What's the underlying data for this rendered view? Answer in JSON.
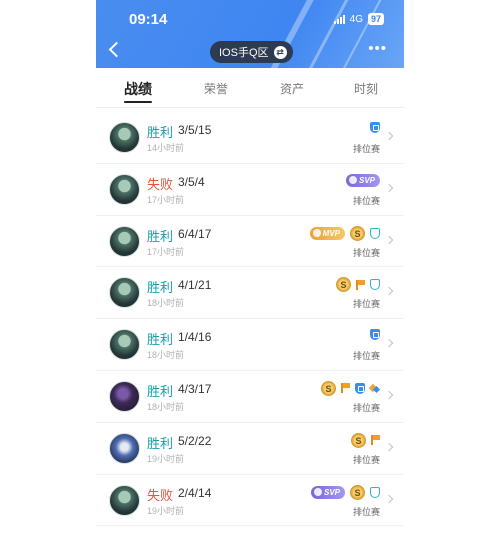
{
  "status_bar": {
    "time": "09:14",
    "network": "4G",
    "battery": "97"
  },
  "header": {
    "region": "IOS手Q区",
    "more": "•••"
  },
  "tabs": [
    {
      "label": "战绩",
      "active": true
    },
    {
      "label": "荣誉"
    },
    {
      "label": "资产"
    },
    {
      "label": "时刻"
    }
  ],
  "matches": [
    {
      "result": "胜利",
      "kda": "3/5/15",
      "time": "14小时前",
      "mode": "排位赛"
    },
    {
      "result": "失败",
      "kda": "3/5/4",
      "time": "17小时前",
      "mode": "排位赛",
      "svp": "SVP"
    },
    {
      "result": "胜利",
      "kda": "6/4/17",
      "time": "17小时前",
      "mode": "排位赛",
      "mvp": "MVP",
      "coin": "S"
    },
    {
      "result": "胜利",
      "kda": "4/1/21",
      "time": "18小时前",
      "mode": "排位赛",
      "coin": "S"
    },
    {
      "result": "胜利",
      "kda": "1/4/16",
      "time": "18小时前",
      "mode": "排位赛"
    },
    {
      "result": "胜利",
      "kda": "4/3/17",
      "time": "18小时前",
      "mode": "排位赛",
      "coin": "S"
    },
    {
      "result": "胜利",
      "kda": "5/2/22",
      "time": "19小时前",
      "mode": "排位赛",
      "coin": "S"
    },
    {
      "result": "失败",
      "kda": "2/4/14",
      "time": "19小时前",
      "mode": "排位赛",
      "svp": "SVP",
      "coin": "S"
    }
  ],
  "colors": {
    "header_blue": "#3f86f2",
    "win": "#1d9aa8",
    "lose": "#e4553b",
    "region_pill": "#2d3b52"
  }
}
